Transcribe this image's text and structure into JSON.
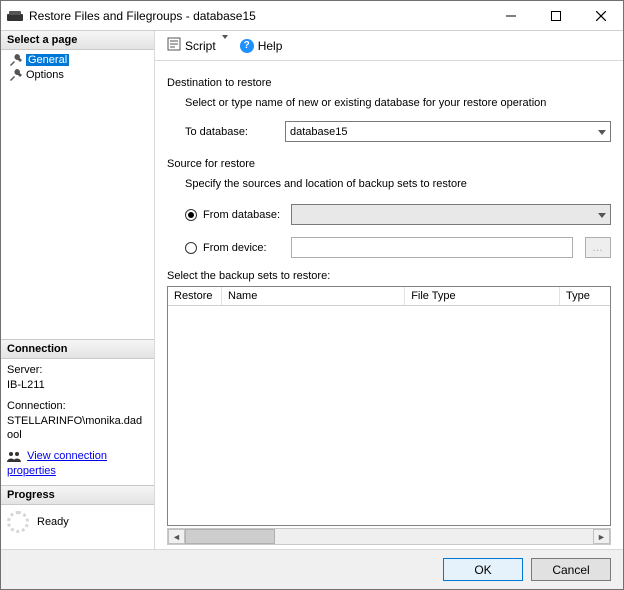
{
  "window": {
    "title": "Restore Files and Filegroups - database15"
  },
  "left": {
    "select_page_header": "Select a page",
    "nav": [
      {
        "label": "General",
        "selected": true
      },
      {
        "label": "Options",
        "selected": false
      }
    ],
    "connection_header": "Connection",
    "connection": {
      "server_label": "Server:",
      "server_value": "IB-L211",
      "connection_label": "Connection:",
      "connection_value": "STELLARINFO\\monika.dadool",
      "view_props": "View connection properties"
    },
    "progress_header": "Progress",
    "progress_status": "Ready"
  },
  "toolbar": {
    "script_label": "Script",
    "help_label": "Help"
  },
  "content": {
    "dest_title": "Destination to restore",
    "dest_sub": "Select or type name of new or existing database for your restore operation",
    "to_db_label": "To database:",
    "to_db_value": "database15",
    "source_title": "Source for restore",
    "source_sub": "Specify the sources and location of backup sets to restore",
    "from_db_label": "From database:",
    "from_db_value": "",
    "from_device_label": "From device:",
    "from_device_value": "",
    "browse_ellipsis": "…",
    "select_sets_label": "Select the backup sets to restore:",
    "grid_headers": {
      "restore": "Restore",
      "name": "Name",
      "file_type": "File Type",
      "type": "Type"
    }
  },
  "footer": {
    "ok": "OK",
    "cancel": "Cancel"
  }
}
